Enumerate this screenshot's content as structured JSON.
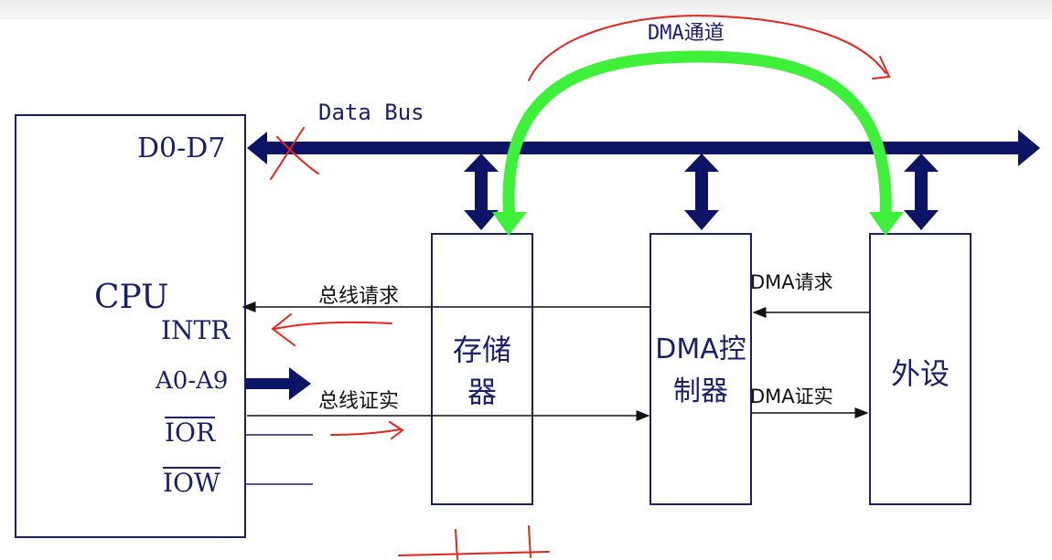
{
  "labels": {
    "dma_channel": "DMA通道",
    "data_bus": "Data Bus",
    "d0_d7": "D0-D7",
    "cpu": "CPU",
    "intr": "INTR",
    "a0_a9": "A0-A9",
    "ior": "IOR",
    "iow": "IOW",
    "bus_request": "总线请求",
    "bus_ack": "总线证实",
    "memory": "存储器",
    "dma_controller": "DMA控制器",
    "peripheral": "外设",
    "dma_request": "DMA请求",
    "dma_ack": "DMA证实"
  },
  "colors": {
    "bus": "#0d1466",
    "box": "#1a1f6b",
    "channel": "#3ef03a",
    "annotation": "#e0261f",
    "signal": "#111111"
  }
}
